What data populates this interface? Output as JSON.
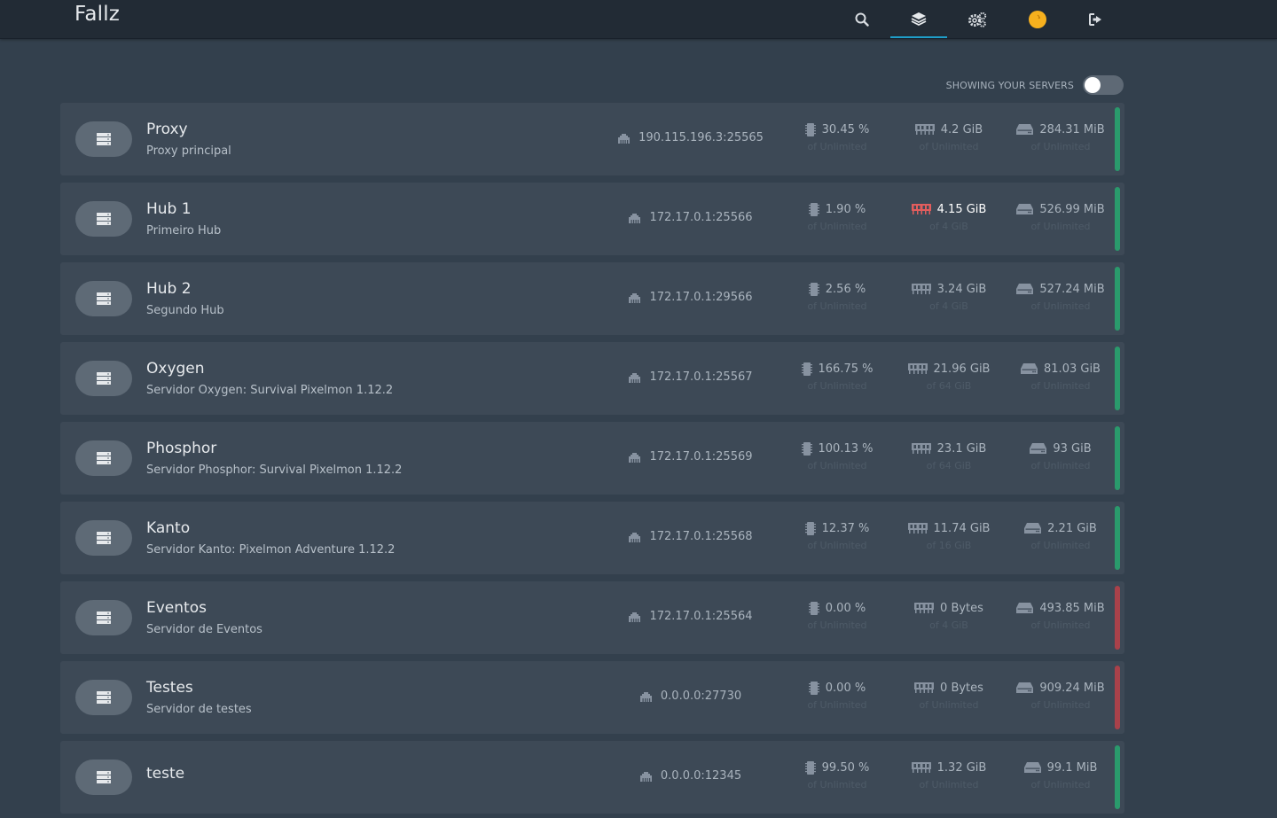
{
  "app": {
    "brand": "Fallz"
  },
  "nav": {
    "icons": [
      "search-icon",
      "layers-icon",
      "settings-icon",
      "user-avatar",
      "logout-icon"
    ],
    "avatar_color": "#f6b01e",
    "active_color": "#1f9ec9"
  },
  "toolbar": {
    "filter_label": "SHOWING YOUR SERVERS",
    "filter_on": false
  },
  "status_colors": {
    "online": "#2a9a6c",
    "offline": "#a9414a",
    "alert": "#e25d5d"
  },
  "servers": [
    {
      "name": "Proxy",
      "description": "Proxy principal",
      "address": "190.115.196.3:25565",
      "cpu": "30.45 %",
      "cpu_limit": "of Unlimited",
      "memory": "4.2 GiB",
      "memory_limit": "of Unlimited",
      "disk": "284.31 MiB",
      "disk_limit": "of Unlimited",
      "status": "online"
    },
    {
      "name": "Hub 1",
      "description": "Primeiro Hub",
      "address": "172.17.0.1:25566",
      "cpu": "1.90 %",
      "cpu_limit": "of Unlimited",
      "memory": "4.15 GiB",
      "memory_limit": "of 4 GiB",
      "memory_alert": true,
      "disk": "526.99 MiB",
      "disk_limit": "of Unlimited",
      "status": "online"
    },
    {
      "name": "Hub 2",
      "description": "Segundo Hub",
      "address": "172.17.0.1:29566",
      "cpu": "2.56 %",
      "cpu_limit": "of Unlimited",
      "memory": "3.24 GiB",
      "memory_limit": "of 4 GiB",
      "disk": "527.24 MiB",
      "disk_limit": "of Unlimited",
      "status": "online"
    },
    {
      "name": "Oxygen",
      "description": "Servidor Oxygen: Survival Pixelmon 1.12.2",
      "address": "172.17.0.1:25567",
      "cpu": "166.75 %",
      "cpu_limit": "of Unlimited",
      "memory": "21.96 GiB",
      "memory_limit": "of 64 GiB",
      "disk": "81.03 GiB",
      "disk_limit": "of Unlimited",
      "status": "online"
    },
    {
      "name": "Phosphor",
      "description": "Servidor Phosphor: Survival Pixelmon 1.12.2",
      "address": "172.17.0.1:25569",
      "cpu": "100.13 %",
      "cpu_limit": "of Unlimited",
      "memory": "23.1 GiB",
      "memory_limit": "of 64 GiB",
      "disk": "93 GiB",
      "disk_limit": "of Unlimited",
      "status": "online"
    },
    {
      "name": "Kanto",
      "description": "Servidor Kanto: Pixelmon Adventure 1.12.2",
      "address": "172.17.0.1:25568",
      "cpu": "12.37 %",
      "cpu_limit": "of Unlimited",
      "memory": "11.74 GiB",
      "memory_limit": "of 16 GiB",
      "disk": "2.21 GiB",
      "disk_limit": "of Unlimited",
      "status": "online"
    },
    {
      "name": "Eventos",
      "description": "Servidor de Eventos",
      "address": "172.17.0.1:25564",
      "cpu": "0.00 %",
      "cpu_limit": "of Unlimited",
      "memory": "0 Bytes",
      "memory_limit": "of 4 GiB",
      "disk": "493.85 MiB",
      "disk_limit": "of Unlimited",
      "status": "offline"
    },
    {
      "name": "Testes",
      "description": "Servidor de testes",
      "address": "0.0.0.0:27730",
      "cpu": "0.00 %",
      "cpu_limit": "of Unlimited",
      "memory": "0 Bytes",
      "memory_limit": "of Unlimited",
      "disk": "909.24 MiB",
      "disk_limit": "of Unlimited",
      "status": "offline"
    },
    {
      "name": "teste",
      "description": "",
      "address": "0.0.0.0:12345",
      "cpu": "99.50 %",
      "cpu_limit": "of Unlimited",
      "memory": "1.32 GiB",
      "memory_limit": "of Unlimited",
      "disk": "99.1 MiB",
      "disk_limit": "of Unlimited",
      "status": "online"
    }
  ]
}
